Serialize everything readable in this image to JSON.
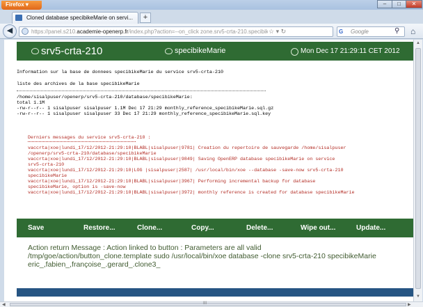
{
  "browser": {
    "menu_label": "Firefox ▾",
    "tab_title": "Cloned database specibikeMarie on servi...",
    "new_tab": "+",
    "url_prefix": "https://panel.s210.",
    "url_domain": "academie-openerp.fr",
    "url_path": "/index.php?action=--on_click zone.srv5-crta-210.specibikeMa",
    "search_placeholder": "Google",
    "search_engine": "G",
    "window_buttons": {
      "minimize": "–",
      "maximize": "□",
      "close": "✕"
    },
    "scroll_center": "III"
  },
  "header": {
    "server": "srv5-crta-210",
    "database": "specibikeMarie",
    "datetime": "Mon Dec 17 21:29:11 CET 2012"
  },
  "info": {
    "line1": "Information sur la base de donnees specibikeMarie du service srv5-crta-210",
    "line2": "liste des archives de la base specibikeMarie",
    "path": "/home/sisalpuser/openerp/srv5-crta-210/database/specibikeMarie:",
    "total": "total 1.1M",
    "file1": "-rw-r--r-- 1 sisalpuser sisalpuser 1.1M Dec 17 21:29 monthly_reference_specibikeMarie.sql.gz",
    "file2": "-rw-r--r-- 1 sisalpuser sisalpuser 33 Dec 17 21:29 monthly_reference_specibikeMarie.sql.key"
  },
  "log": {
    "title": "Derniers messages du service srv5-crta-210 :",
    "lines": [
      "vaccrta|xoe|lundi_17/12/2012-21:29:10|BLABL|sisalpuser|9781| Creation du repertoire de sauvegarde /home/sisalpuser",
      "/openerp/srv5-crta-210/database/specibikeMarie",
      "vaccrta|xoe|lundi_17/12/2012-21:29:10|BLABL|sisalpuser|9849| Saving OpenERP database specibikeMarie on service",
      "srv5-crta-210",
      "vaccrta|xoe|lundi_17/12/2012-21:29:10|LOG |sisalpuser|2587| /usr/local/bin/xoe --database -save-now srv5-crta-210",
      "specibikeMarie",
      "vaccrta|xoe|lundi_17/12/2012-21:29:10|BLABL|sisalpuser|3967| Performing incremental backup for database",
      "specibikeMarie, option is -save-now",
      "vaccrta|xoe|lundi_17/12/2012-21:29:10|BLABL|sisalpuser|3972| monthly reference is created for database specibikeMarie"
    ]
  },
  "toolbar": {
    "save": "Save",
    "restore": "Restore...",
    "clone": "Clone...",
    "copy": "Copy...",
    "delete": "Delete...",
    "wipe": "Wipe out...",
    "update": "Update..."
  },
  "message": {
    "line1": "Action return Message : Action linked to button : Parameters are all valid",
    "line2": "/tmp/goe/action/button_clone.template sudo /usr/local/bin/xoe database -clone srv5-crta-210 specibikeMarie",
    "line3": "eric_,fabien_,françoise_.gerard_.clone3_"
  },
  "colors": {
    "header_green": "#2f6b33",
    "log_red": "#b22a22",
    "message_green": "#3f5a2f",
    "footer_blue": "#265583"
  }
}
